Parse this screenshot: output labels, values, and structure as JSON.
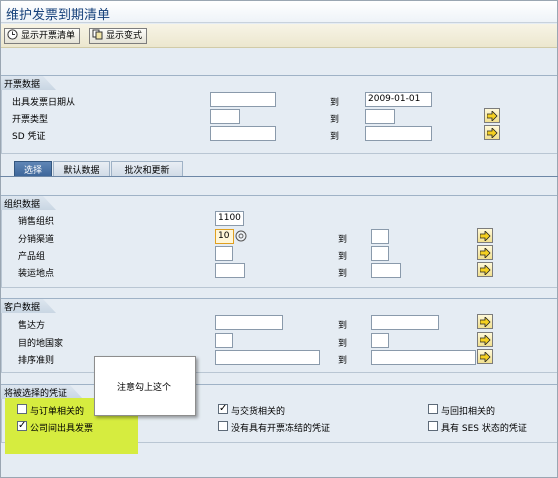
{
  "title": "维护发票到期清单",
  "toolbar": {
    "display_list": "显示开票清单",
    "display_variant": "显示变式"
  },
  "billing": {
    "header": "开票数据",
    "date_label": "出具发票日期从",
    "date_to_label": "到",
    "date_from_value": "",
    "date_to_value": "2009-01-01",
    "type_label": "开票类型",
    "type_to_label": "到",
    "sd_label": "SD 凭证",
    "sd_to_label": "到"
  },
  "tabs": [
    "选择",
    "默认数据",
    "批次和更新"
  ],
  "org": {
    "header": "组织数据",
    "sales_org_label": "销售组织",
    "sales_org_value": "1100",
    "channel_label": "分销渠道",
    "channel_value": "10",
    "channel_to_label": "到",
    "division_label": "产品组",
    "division_to_label": "到",
    "shipping_label": "装运地点",
    "shipping_to_label": "到"
  },
  "customer": {
    "header": "客户数据",
    "soldto_label": "售达方",
    "soldto_to_label": "到",
    "country_label": "目的地国家",
    "country_to_label": "到",
    "sort_label": "排序准则",
    "sort_to_label": "到"
  },
  "docs": {
    "header": "将被选择的凭证",
    "order_related": {
      "label": "与订单相关的",
      "checked": false
    },
    "intercompany": {
      "label": "公司间出具发票",
      "checked": true
    },
    "delivery_related": {
      "label": "与交货相关的",
      "checked": true
    },
    "no_billing_block": {
      "label": "没有具有开票冻结的凭证",
      "checked": false
    },
    "rebate_related": {
      "label": "与回扣相关的",
      "checked": false
    },
    "ses_status": {
      "label": "具有 SES 状态的凭证",
      "checked": false
    }
  },
  "callout": "注意勾上这个",
  "colors": {
    "highlight": "#d6ec3f",
    "active_tab": "#4a72a6",
    "title_text": "#15407a"
  }
}
